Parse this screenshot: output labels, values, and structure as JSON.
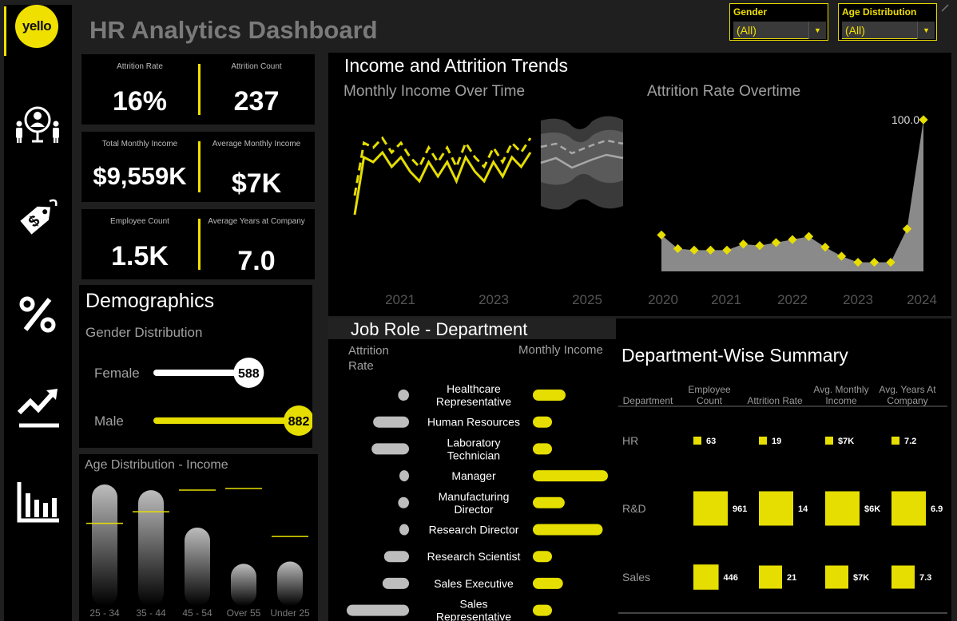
{
  "app": {
    "title": "HR Analytics Dashboard",
    "logo_text": "yello"
  },
  "sidebar": {
    "icons": [
      "people-icon",
      "price-tag-icon",
      "percent-icon",
      "trend-chart-icon",
      "bar-chart-icon"
    ]
  },
  "filters": [
    {
      "label": "Gender",
      "value": "(All)"
    },
    {
      "label": "Age Distribution",
      "value": "(All)"
    }
  ],
  "kpis": [
    {
      "label": "Attrition Rate",
      "value": "16%"
    },
    {
      "label": "Attrition Count",
      "value": "237"
    },
    {
      "label": "Total Monthly Income",
      "value": "$9,559K"
    },
    {
      "label": "Average Monthly Income",
      "value": "$7K"
    },
    {
      "label": "Employee Count",
      "value": "1.5K"
    },
    {
      "label": "Average Years at Company",
      "value": "7.0"
    }
  ],
  "demographics": {
    "title": "Demographics",
    "subtitle": "Gender Distribution",
    "genders": [
      {
        "label": "Female",
        "count": 588,
        "count_label": "588",
        "color": "#ffffff"
      },
      {
        "label": "Male",
        "count": 882,
        "count_label": "882",
        "color": "#e6de00"
      }
    ]
  },
  "colors": {
    "accent": "#e6de00",
    "panel": "#000000",
    "background": "#1f1f1f",
    "muted": "#a0a0a0"
  },
  "chart_data": [
    {
      "type": "line",
      "title": "Income and Attrition Trends",
      "subtitle": "Monthly Income Over Time",
      "x_ticks": [
        "2021",
        "2023",
        "2025"
      ],
      "series": [
        {
          "values": [
            5.8,
            6.9,
            6.8,
            7.0,
            6.7,
            6.9,
            6.6,
            6.4,
            6.8,
            6.5,
            6.8,
            6.4,
            6.9,
            6.6,
            6.4,
            6.8,
            6.5,
            6.9,
            6.7,
            7.0
          ]
        },
        {
          "values": [
            5.4,
            6.6,
            6.5,
            6.7,
            6.4,
            6.6,
            6.3,
            6.1,
            6.5,
            6.2,
            6.5,
            6.1,
            6.6,
            6.3,
            6.1,
            6.5,
            6.2,
            6.6,
            6.4,
            6.7
          ]
        }
      ],
      "forecast_band": true
    },
    {
      "type": "area",
      "subtitle": "Attrition Rate Overtime",
      "x_ticks": [
        "2020",
        "2021",
        "2022",
        "2023",
        "2024"
      ],
      "values": [
        24,
        15,
        14,
        14,
        14,
        18,
        17,
        19,
        21,
        23,
        16,
        10,
        6,
        6,
        6,
        28,
        100
      ],
      "peak_label": "100.0",
      "ylim": [
        0,
        100
      ]
    },
    {
      "type": "bar",
      "title": "Job Role - Department",
      "left_label": "Attrition Rate",
      "right_label": "Monthly Income",
      "categories": [
        "Healthcare Representative",
        "Human Resources",
        "Laboratory Technician",
        "Manager",
        "Manufacturing Director",
        "Research Director",
        "Research Scientist",
        "Sales Executive",
        "Sales Representative"
      ],
      "attrition_rate": [
        7,
        23,
        24,
        5,
        7,
        2,
        16,
        17,
        40
      ],
      "monthly_income": [
        7.5,
        4.2,
        3.2,
        17.2,
        7.3,
        16.0,
        3.2,
        6.9,
        2.6
      ]
    },
    {
      "type": "table",
      "title": "Department-Wise Summary",
      "columns": [
        "Department",
        "Employee Count",
        "Attrition Rate",
        "Avg. Monthly Income",
        "Avg. Years At Company"
      ],
      "rows": [
        {
          "department": "HR",
          "employee_count": 63,
          "attrition_rate": 19,
          "avg_income": 7,
          "avg_years": 7.2,
          "labels": [
            "63",
            "19",
            "$7K",
            "7.2"
          ]
        },
        {
          "department": "R&D",
          "employee_count": 961,
          "attrition_rate": 14,
          "avg_income": 6,
          "avg_years": 6.9,
          "labels": [
            "961",
            "14",
            "$6K",
            "6.9"
          ]
        },
        {
          "department": "Sales",
          "employee_count": 446,
          "attrition_rate": 21,
          "avg_income": 7,
          "avg_years": 7.3,
          "labels": [
            "446",
            "21",
            "$7K",
            "7.3"
          ]
        }
      ]
    },
    {
      "type": "bar",
      "title": "Age Distribution - Income",
      "categories": [
        "25 - 34",
        "35 - 44",
        "45 - 54",
        "Over 55",
        "Under 25"
      ],
      "employee_share": [
        100,
        95,
        62,
        30,
        32
      ],
      "income_marker": [
        55,
        70,
        98,
        100,
        38
      ]
    }
  ]
}
